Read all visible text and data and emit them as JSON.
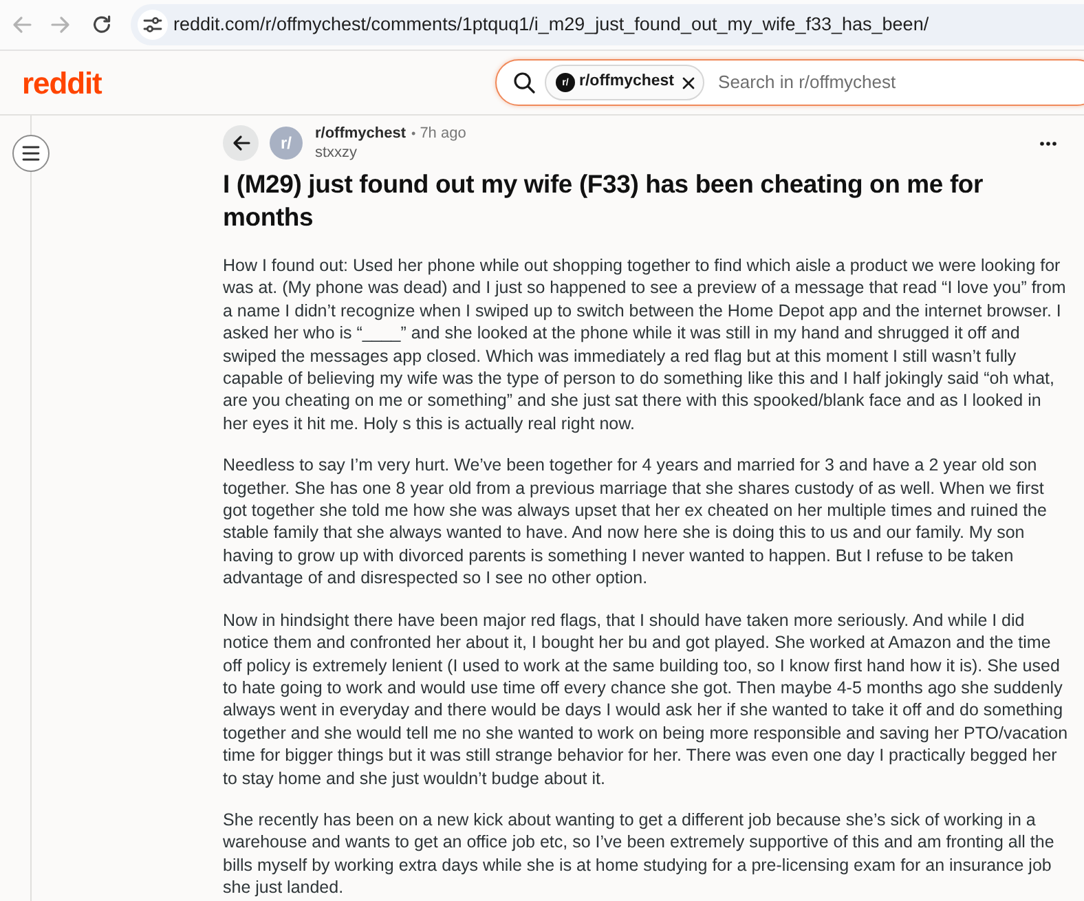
{
  "browser": {
    "url": "reddit.com/r/offmychest/comments/1ptquq1/i_m29_just_found_out_my_wife_f33_has_been/"
  },
  "header": {
    "logo": "reddit",
    "search": {
      "chip": {
        "avatar": "r/",
        "label": "r/offmychest"
      },
      "placeholder": "Search in r/offmychest"
    }
  },
  "post": {
    "avatar": "r/",
    "subreddit": "r/offmychest",
    "separator": "•",
    "time": "7h ago",
    "author": "stxxzy",
    "title": "I (M29) just found out my wife (F33) has been cheating on me for months",
    "paragraphs": [
      "How I found out: Used her phone while out shopping together to find which aisle a product we were looking for was at. (My phone was dead) and I just so happened to see a preview of a message that read “I love you” from a name I didn’t recognize when I swiped up to switch between the Home Depot app and the internet browser. I asked her who is “____” and she looked at the phone while it was still in my hand and shrugged it off and swiped the messages app closed. Which was immediately a red flag but at this moment I still wasn’t fully capable of believing my wife was the type of person to do something like this and I half jokingly said “oh what, are you cheating on me or something” and she just sat there with this spooked/blank face and as I looked in her eyes it hit me. Holy s this is actually real right now.",
      "Needless to say I’m very hurt. We’ve been together for 4 years and married for 3 and have a 2 year old son together. She has one 8 year old from a previous marriage that she shares custody of as well. When we first got together she told me how she was always upset that her ex cheated on her multiple times and ruined the stable family that she always wanted to have. And now here she is doing this to us and our family. My son having to grow up with divorced parents is something I never wanted to happen. But I refuse to be taken advantage of and disrespected so I see no other option.",
      "Now in hindsight there have been major red flags, that I should have taken more seriously. And while I did notice them and confronted her about it, I bought her bu and got played. She worked at Amazon and the time off policy is extremely lenient (I used to work at the same building too, so I know first hand how it is). She used to hate going to work and would use time off every chance she got. Then maybe 4-5 months ago she suddenly always went in everyday and there would be days I would ask her if she wanted to take it off and do something together and she would tell me no she wanted to work on being more responsible and saving her PTO/vacation time for bigger things but it was still strange behavior for her. There was even one day I practically begged her to stay home and she just wouldn’t budge about it.",
      "She recently has been on a new kick about wanting to get a different job because she’s sick of working in a warehouse and wants to get an office job etc, so I’ve been extremely supportive of this and am fronting all the bills myself by working extra days while she is at home studying for a pre-licensing exam for an insurance job she just landed."
    ]
  }
}
